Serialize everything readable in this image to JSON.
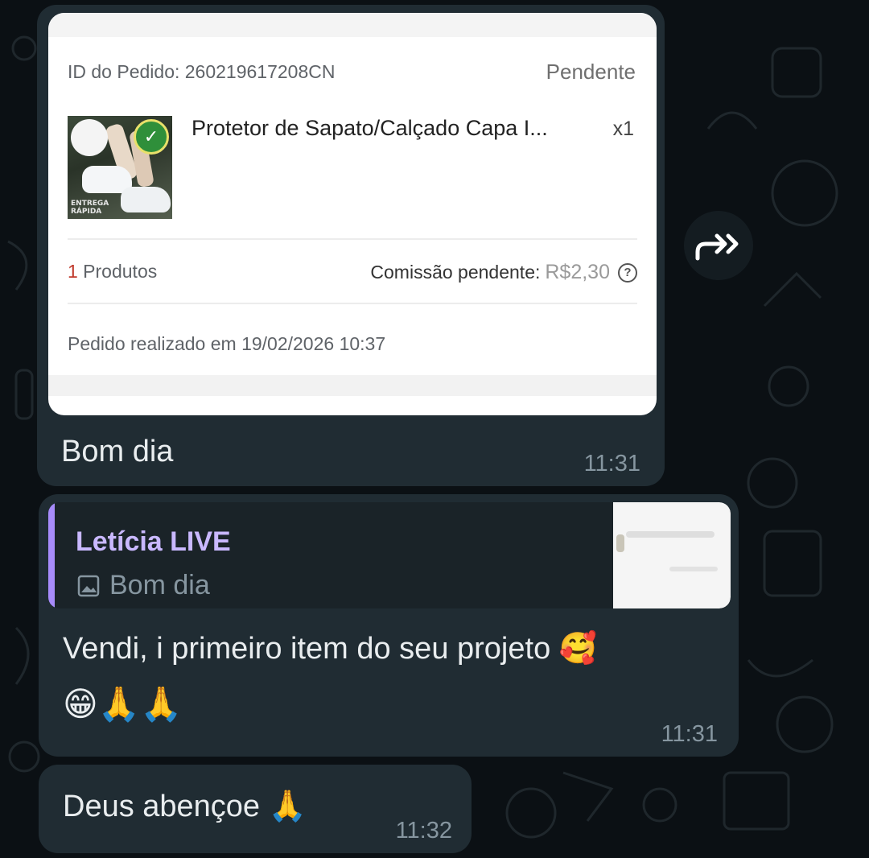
{
  "order_card": {
    "order_id": "ID do Pedido: 260219617208CN",
    "status": "Pendente",
    "product_name": "Protetor de Sapato/Calçado Capa I...",
    "quantity": "x1",
    "product_count_num": "1",
    "product_count_label": " Produtos",
    "commission_label": "Comissão pendente:",
    "commission_value": "R$2,30",
    "help_symbol": "?",
    "placed_at": "Pedido realizado em 19/02/2026 10:37",
    "thumb_tag_line1": "ENTREGA",
    "thumb_tag_line2": "RÁPIDA"
  },
  "messages": [
    {
      "text": "Bom dia",
      "time": "11:31"
    },
    {
      "quote_author": "Letícia LIVE",
      "quote_text": "Bom dia",
      "line1": "Vendi, i primeiro item do seu projeto 🥰",
      "line2": "😁🙏🙏",
      "time": "11:31"
    },
    {
      "text": "Deus abençoe 🙏",
      "time": "11:32"
    }
  ],
  "colors": {
    "background": "#0b1014",
    "bubble": "#202c33",
    "quote_accent": "#a78bfa",
    "quote_author": "#c9b8ff",
    "timestamp": "#8696a0",
    "product_count_accent": "#c0392b"
  },
  "icons": {
    "forward": "forward-icon",
    "image": "image-icon",
    "help": "help-circle-icon",
    "seal": "check-seal-icon"
  }
}
